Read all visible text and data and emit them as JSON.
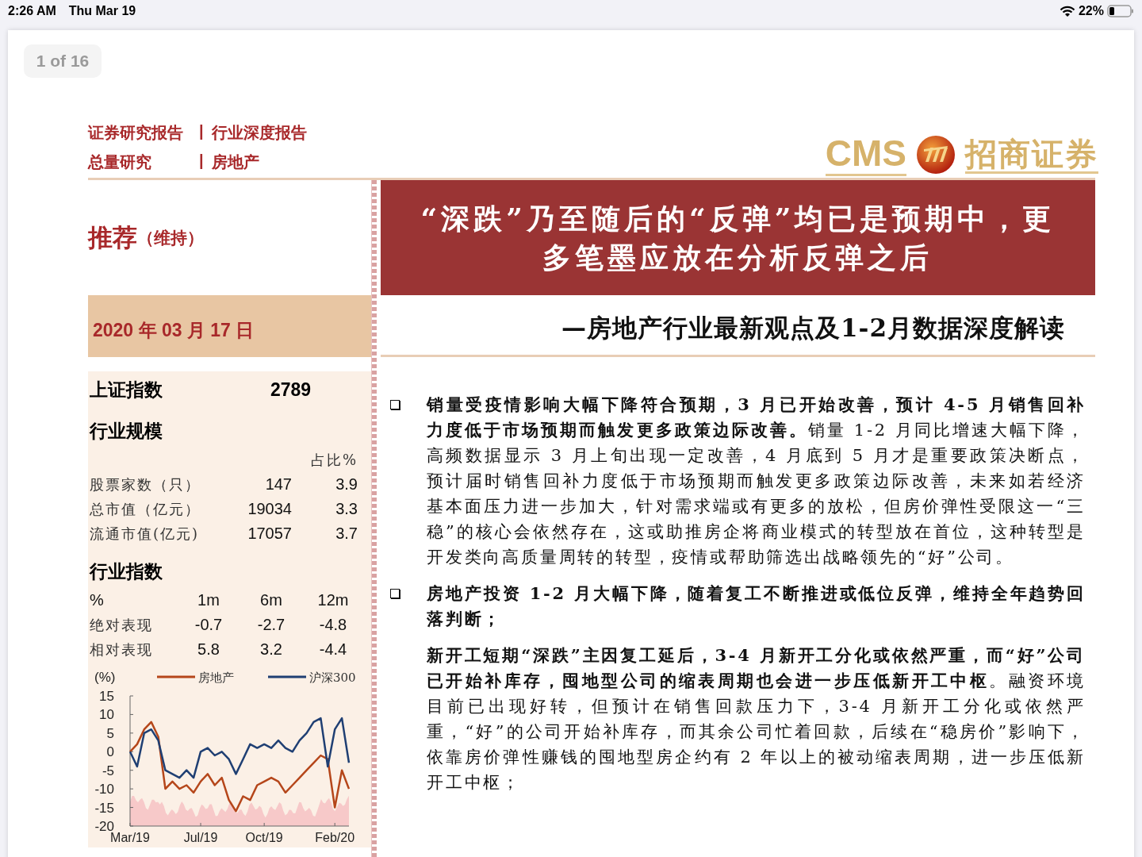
{
  "status_bar": {
    "time": "2:26 AM",
    "date": "Thu Mar 19",
    "battery": "22%"
  },
  "viewer": {
    "page_indicator": "1 of 16"
  },
  "header": {
    "lines": [
      {
        "left": "证券研究报告",
        "right": "行业深度报告"
      },
      {
        "left": "总量研究",
        "right": "房地产"
      }
    ],
    "separator": "|",
    "logo": {
      "latin": "CMS",
      "name": "招商证券"
    }
  },
  "rating": {
    "label": "推荐",
    "note": "（维持）"
  },
  "date": "2020 年 03 月 17 日",
  "title_lines": [
    "“深跌”乃至随后的“反弹”均已是预期中，更",
    "多笔墨应放在分析反弹之后"
  ],
  "subtitle": "—房地产行业最新观点及1-2月数据深度解读",
  "sidebar": {
    "index": {
      "label": "上证指数",
      "value": "2789"
    },
    "scale": {
      "title": "行业规模",
      "share_header": "占比%",
      "rows": [
        {
          "label": "股票家数（只）",
          "count": "147",
          "share": "3.9"
        },
        {
          "label": "总市值（亿元）",
          "count": "19034",
          "share": "3.3"
        },
        {
          "label": "流通市值(亿元)",
          "count": "17057",
          "share": "3.7"
        }
      ]
    },
    "performance": {
      "title": "行业指数",
      "headers": [
        "%",
        "1m",
        "6m",
        "12m"
      ],
      "rows": [
        {
          "label": "绝对表现",
          "values": [
            "-0.7",
            "-2.7",
            "-4.8"
          ]
        },
        {
          "label": "相对表现",
          "values": [
            "5.8",
            "3.2",
            "-4.4"
          ]
        }
      ]
    },
    "chart": {
      "chart_data": {
        "type": "line",
        "ylabel": "(%)",
        "categories": [
          "Mar/19",
          null,
          null,
          null,
          null,
          null,
          null,
          null,
          null,
          null,
          "Jul/19",
          null,
          null,
          null,
          null,
          null,
          null,
          null,
          null,
          "Oct/19",
          null,
          null,
          null,
          null,
          null,
          null,
          null,
          null,
          null,
          "Feb/20",
          null,
          null
        ],
        "legend": "top",
        "ylim": [
          -20,
          15
        ],
        "yticks": [
          15,
          10,
          5,
          0,
          -5,
          -10,
          -15,
          -20
        ],
        "series": [
          {
            "name": "房地产",
            "color": "#b5461a",
            "values": [
              0,
              2,
              6,
              8,
              4,
              -10,
              -8,
              -10,
              -9,
              -11,
              -8,
              -6,
              -9,
              -7,
              -13,
              -16,
              -12,
              -13,
              -9,
              -8,
              -7,
              -8,
              -11,
              -9,
              -7,
              -5,
              -3,
              -1,
              -2,
              -15,
              -5,
              -10
            ]
          },
          {
            "name": "沪深300",
            "color": "#1f3f73",
            "values": [
              0,
              -4,
              5,
              6,
              3,
              -5,
              -6,
              -7,
              -5,
              -7,
              0,
              1,
              -1,
              0,
              -2,
              -6,
              -2,
              2,
              1,
              2,
              1,
              3,
              1,
              0,
              3,
              5,
              8,
              9,
              -4,
              6,
              9,
              -3
            ]
          }
        ]
      }
    }
  },
  "paragraphs": [
    {
      "bullet": true,
      "bold": false,
      "text": "**销量受疫情影响大幅下降符合预期，3 月已开始改善，预计 4-5 月销售回补力度低于市场预期而触发更多政策边际改善。**销量 1-2 月同比增速大幅下降，高频数据显示 3 月上旬出现一定改善，4 月底到 5 月才是重要政策决断点，预计届时销售回补力度低于市场预期而触发更多政策边际改善，未来如若经济基本面压力进一步加大，针对需求端或有更多的放松，但房价弹性受限这一“三稳”的核心会依然存在，这或助推房企将商业模式的转型放在首位，这种转型是开发类向高质量周转的转型，疫情或帮助筛选出战略领先的“好”公司。"
    },
    {
      "bullet": true,
      "bold": true,
      "text": "房地产投资 1-2 月大幅下降，随着复工不断推进或低位反弹，维持全年趋势回落判断；"
    },
    {
      "bullet": false,
      "bold": false,
      "text": "**新开工短期“深跌”主因复工延后，3-4 月新开工分化或依然严重，而“好”公司已开始补库存，囤地型公司的缩表周期也会进一步压低新开工中枢**。融资环境目前已出现好转，但预计在销售回款压力下，3-4 月新开工分化或依然严重，“好”的公司开始补库存，而其余公司忙着回款，后续在“稳房价”影响下，依靠房价弹性赚钱的囤地型房企约有 2 年以上的被动缩表周期，进一步压低新开工中枢；"
    }
  ]
}
